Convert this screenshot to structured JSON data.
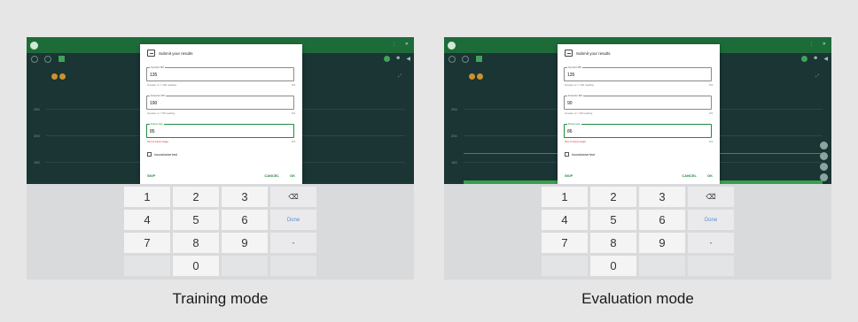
{
  "panels": [
    {
      "caption": "Training mode",
      "dialog": {
        "title": "Submit your results",
        "fields": [
          {
            "label": "Systolic BP",
            "value": "135",
            "helper": "Greater or = 130 reading",
            "counter": "3/3"
          },
          {
            "label": "Diastolic BP",
            "value": "190",
            "helper": "Greater or = 80 reading",
            "counter": "3/3"
          },
          {
            "label": "Pulse rate",
            "value": "85",
            "helper": "Out of input range",
            "counter": "2/3"
          }
        ],
        "checkbox_label": "Inconclusive test",
        "actions": {
          "skip": "SKIP",
          "cancel": "CANCEL",
          "ok": "OK"
        }
      }
    },
    {
      "caption": "Evaluation mode",
      "dialog": {
        "title": "Submit your results",
        "fields": [
          {
            "label": "Systolic BP",
            "value": "135",
            "helper": "Greater or = 130 reading",
            "counter": "3/3"
          },
          {
            "label": "Diastolic BP",
            "value": "90",
            "helper": "Greater or = 80 reading",
            "counter": "2/3"
          },
          {
            "label": "Pulse rate",
            "value": "86",
            "helper": "Out of input range",
            "counter": "2/3"
          }
        ],
        "checkbox_label": "Inconclusive test",
        "actions": {
          "skip": "SKIP",
          "cancel": "CANCEL",
          "ok": "OK"
        }
      }
    }
  ],
  "keyboard": {
    "keys": [
      "1",
      "2",
      "3",
      "⌫",
      "4",
      "5",
      "6",
      "Done",
      "7",
      "8",
      "9",
      "-",
      "",
      "0",
      "",
      ""
    ]
  },
  "chart": {
    "yticks": [
      "150",
      "200",
      "250"
    ],
    "colors": {
      "appbar": "#1e6b3a",
      "chart_bg": "#1b3434",
      "accent": "#1f8a3e",
      "error": "#c62828"
    }
  }
}
